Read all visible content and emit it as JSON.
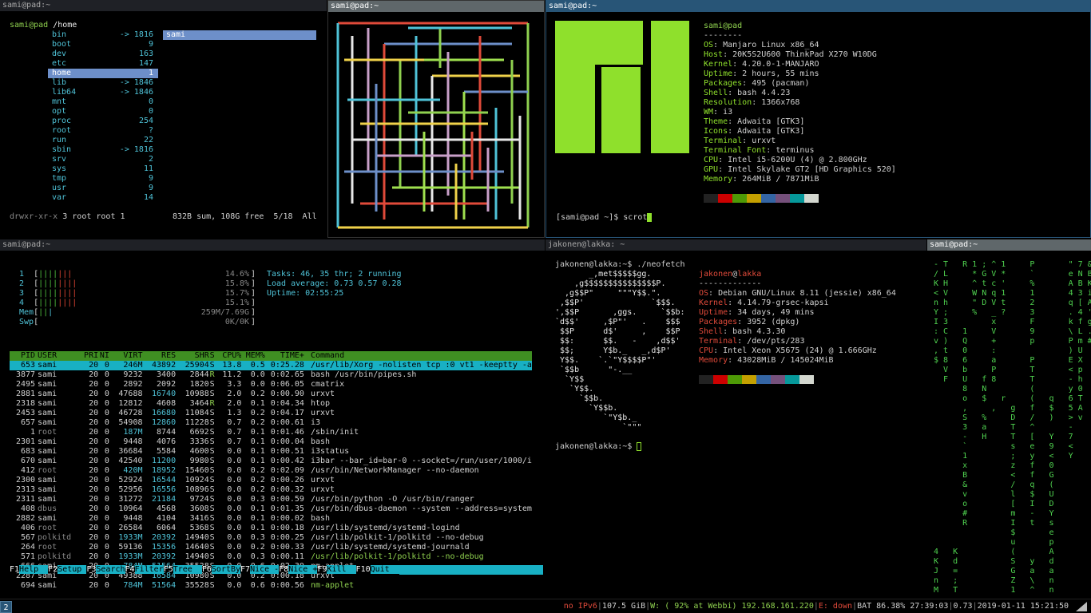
{
  "ranger": {
    "title": "sami@pad:~",
    "path_user": "sami@pad",
    "path_dir": "/home",
    "entries": [
      {
        "name": "bin",
        "size": "-> 1816",
        "link": true
      },
      {
        "name": "boot",
        "size": "9"
      },
      {
        "name": "dev",
        "size": "163"
      },
      {
        "name": "etc",
        "size": "147"
      },
      {
        "name": "home",
        "size": "1",
        "selected": true
      },
      {
        "name": "lib",
        "size": "-> 1846",
        "link": true
      },
      {
        "name": "lib64",
        "size": "-> 1846",
        "link": true
      },
      {
        "name": "mnt",
        "size": "0"
      },
      {
        "name": "opt",
        "size": "0"
      },
      {
        "name": "proc",
        "size": "254"
      },
      {
        "name": "root",
        "size": "?"
      },
      {
        "name": "run",
        "size": "22"
      },
      {
        "name": "sbin",
        "size": "-> 1816",
        "link": true
      },
      {
        "name": "srv",
        "size": "2"
      },
      {
        "name": "sys",
        "size": "11"
      },
      {
        "name": "tmp",
        "size": "9"
      },
      {
        "name": "usr",
        "size": "9"
      },
      {
        "name": "var",
        "size": "14"
      }
    ],
    "preview_item": "sami",
    "status_perms": "drwxr-xr-x",
    "status_info": "3 root root 1",
    "status_right": "832B sum, 108G free  5/18  All"
  },
  "pipes": {
    "title": "sami@pad:~"
  },
  "neofetch_top": {
    "title": "sami@pad:~",
    "user": "sami@pad",
    "divider": "--------",
    "info": [
      {
        "key": "OS",
        "value": "Manjaro Linux x86_64"
      },
      {
        "key": "Host",
        "value": "20K5S2U600 ThinkPad X270 W10DG"
      },
      {
        "key": "Kernel",
        "value": "4.20.0-1-MANJARO"
      },
      {
        "key": "Uptime",
        "value": "2 hours, 55 mins"
      },
      {
        "key": "Packages",
        "value": "495 (pacman)"
      },
      {
        "key": "Shell",
        "value": "bash 4.4.23"
      },
      {
        "key": "Resolution",
        "value": "1366x768"
      },
      {
        "key": "WM",
        "value": "i3"
      },
      {
        "key": "Theme",
        "value": "Adwaita [GTK3]"
      },
      {
        "key": "Icons",
        "value": "Adwaita [GTK3]"
      },
      {
        "key": "Terminal",
        "value": "urxvt"
      },
      {
        "key": "Terminal Font",
        "value": "terminus"
      },
      {
        "key": "CPU",
        "value": "Intel i5-6200U (4) @ 2.800GHz"
      },
      {
        "key": "GPU",
        "value": "Intel Skylake GT2 [HD Graphics 520]"
      },
      {
        "key": "Memory",
        "value": "264MiB / 7871MiB"
      }
    ],
    "palette": [
      "#222222",
      "#cc0000",
      "#4e9a06",
      "#c4a000",
      "#3465a4",
      "#75507b",
      "#06989a",
      "#d3d7cf"
    ],
    "prompt": "[sami@pad ~]$ scrot",
    "logo_color": "#8fe02c"
  },
  "htop": {
    "title": "sami@pad:~",
    "cpus": [
      {
        "n": "1",
        "pct": "14.6%"
      },
      {
        "n": "2",
        "pct": "15.8%"
      },
      {
        "n": "3",
        "pct": "15.7%"
      },
      {
        "n": "4",
        "pct": "15.1%"
      }
    ],
    "mem_label": "Mem",
    "mem_value": "259M/7.69G",
    "swp_label": "Swp",
    "swp_value": "0K/0K",
    "tasks": "Tasks: 46, 35 thr; 2 running",
    "load": "Load average: 0.73 0.57 0.28",
    "uptime": "Uptime: 02:55:25",
    "columns": [
      "PID",
      "USER",
      "PRI",
      "NI",
      "VIRT",
      "RES",
      "SHR",
      "S",
      "CPU%",
      "MEM%",
      "TIME+",
      "Command"
    ],
    "rows": [
      [
        "653",
        "sami",
        "20",
        "0",
        "246M",
        "43892",
        "25904",
        "S",
        "13.8",
        "0.5",
        "0:25.28",
        "/usr/lib/Xorg -nolisten tcp :0 vt1 -keeptty -a"
      ],
      [
        "3877",
        "sami",
        "20",
        "0",
        "9232",
        "3400",
        "2844",
        "R",
        "11.2",
        "0.0",
        "0:02.65",
        "bash /usr/bin/pipes.sh"
      ],
      [
        "2495",
        "sami",
        "20",
        "0",
        "2892",
        "2092",
        "1820",
        "S",
        "3.3",
        "0.0",
        "0:06.05",
        "cmatrix"
      ],
      [
        "2881",
        "sami",
        "20",
        "0",
        "47688",
        "16740",
        "10988",
        "S",
        "2.0",
        "0.2",
        "0:00.90",
        "urxvt"
      ],
      [
        "2318",
        "sami",
        "20",
        "0",
        "12812",
        "4608",
        "3464",
        "R",
        "2.0",
        "0.1",
        "0:04.34",
        "htop"
      ],
      [
        "2453",
        "sami",
        "20",
        "0",
        "46728",
        "16680",
        "11084",
        "S",
        "1.3",
        "0.2",
        "0:04.17",
        "urxvt"
      ],
      [
        "657",
        "sami",
        "20",
        "0",
        "54908",
        "12860",
        "11228",
        "S",
        "0.7",
        "0.2",
        "0:00.61",
        "i3"
      ],
      [
        "1",
        "root",
        "20",
        "0",
        "187M",
        "8744",
        "6692",
        "S",
        "0.7",
        "0.1",
        "0:01.46",
        "/sbin/init"
      ],
      [
        "2301",
        "sami",
        "20",
        "0",
        "9448",
        "4076",
        "3336",
        "S",
        "0.7",
        "0.1",
        "0:00.04",
        "bash"
      ],
      [
        "683",
        "sami",
        "20",
        "0",
        "36684",
        "5584",
        "4600",
        "S",
        "0.0",
        "0.1",
        "0:00.51",
        "i3status"
      ],
      [
        "670",
        "sami",
        "20",
        "0",
        "42540",
        "11200",
        "9980",
        "S",
        "0.0",
        "0.1",
        "0:00.42",
        "i3bar --bar_id=bar-0 --socket=/run/user/1000/i"
      ],
      [
        "412",
        "root",
        "20",
        "0",
        "420M",
        "18952",
        "15460",
        "S",
        "0.0",
        "0.2",
        "0:02.09",
        "/usr/bin/NetworkManager --no-daemon"
      ],
      [
        "2300",
        "sami",
        "20",
        "0",
        "52924",
        "16544",
        "10924",
        "S",
        "0.0",
        "0.2",
        "0:00.26",
        "urxvt"
      ],
      [
        "2313",
        "sami",
        "20",
        "0",
        "52956",
        "16556",
        "10896",
        "S",
        "0.0",
        "0.2",
        "0:00.32",
        "urxvt"
      ],
      [
        "2311",
        "sami",
        "20",
        "0",
        "31272",
        "21184",
        "9724",
        "S",
        "0.0",
        "0.3",
        "0:00.59",
        "/usr/bin/python -O /usr/bin/ranger"
      ],
      [
        "408",
        "dbus",
        "20",
        "0",
        "10964",
        "4568",
        "3608",
        "S",
        "0.0",
        "0.1",
        "0:01.35",
        "/usr/bin/dbus-daemon --system --address=system"
      ],
      [
        "2882",
        "sami",
        "20",
        "0",
        "9448",
        "4104",
        "3416",
        "S",
        "0.0",
        "0.1",
        "0:00.02",
        "bash"
      ],
      [
        "406",
        "root",
        "20",
        "0",
        "26584",
        "6064",
        "5368",
        "S",
        "0.0",
        "0.1",
        "0:00.18",
        "/usr/lib/systemd/systemd-logind"
      ],
      [
        "567",
        "polkitd",
        "20",
        "0",
        "1933M",
        "20392",
        "14940",
        "S",
        "0.0",
        "0.3",
        "0:00.25",
        "/usr/lib/polkit-1/polkitd --no-debug"
      ],
      [
        "264",
        "root",
        "20",
        "0",
        "59136",
        "15356",
        "14640",
        "S",
        "0.0",
        "0.2",
        "0:00.33",
        "/usr/lib/systemd/systemd-journald"
      ],
      [
        "571",
        "polkitd",
        "20",
        "0",
        "1933M",
        "20392",
        "14940",
        "S",
        "0.0",
        "0.3",
        "0:00.11",
        "/usr/lib/polkit-1/polkitd --no-debug"
      ],
      [
        "666",
        "sami",
        "20",
        "0",
        "784M",
        "51564",
        "35528",
        "S",
        "0.0",
        "0.6",
        "0:02.30",
        "nm-applet"
      ],
      [
        "2287",
        "sami",
        "20",
        "0",
        "49388",
        "16584",
        "10980",
        "S",
        "0.0",
        "0.2",
        "0:00.18",
        "urxvt"
      ],
      [
        "694",
        "sami",
        "20",
        "0",
        "784M",
        "51564",
        "35528",
        "S",
        "0.0",
        "0.6",
        "0:00.56",
        "nm-applet"
      ]
    ],
    "fkeys": [
      {
        "k": "F1",
        "l": "Help  "
      },
      {
        "k": "F2",
        "l": "Setup "
      },
      {
        "k": "F3",
        "l": "Search"
      },
      {
        "k": "F4",
        "l": "Filter"
      },
      {
        "k": "F5",
        "l": "Tree  "
      },
      {
        "k": "F6",
        "l": "SortBy"
      },
      {
        "k": "F7",
        "l": "Nice -"
      },
      {
        "k": "F8",
        "l": "Nice +"
      },
      {
        "k": "F9",
        "l": "Kill  "
      },
      {
        "k": "F10",
        "l": "Quit  "
      }
    ]
  },
  "neofetch_debian": {
    "title": "jakonen@lakka: ~",
    "command": "jakonen@lakka:~$ ./neofetch",
    "user": "jakonen",
    "host": "lakka",
    "divider": "-------------",
    "logo": [
      "       _,met$$$$$gg.",
      "    ,g$$$$$$$$$$$$$$$P.",
      "  ,g$$P\"     \"\"\"Y$$.\".",
      " ,$$P'              `$$$.",
      "',$$P       ,ggs.     `$$b:",
      "`d$$'     ,$P\"'   .    $$$",
      " $$P      d$'     ,    $$P",
      " $$:      $$.   -    ,d$$'",
      " $$;      Y$b._   _,d$P'",
      " Y$$.    `.`\"Y$$$$P\"'",
      " `$$b      \"-.__",
      "  `Y$$",
      "   `Y$$.",
      "     `$$b.",
      "       `Y$$b.",
      "          `\"Y$b._",
      "              `\"\"\""
    ],
    "info": [
      {
        "key": "OS",
        "value": "Debian GNU/Linux 8.11 (jessie) x86_64"
      },
      {
        "key": "Kernel",
        "value": "4.14.79-grsec-kapsi"
      },
      {
        "key": "Uptime",
        "value": "34 days, 49 mins"
      },
      {
        "key": "Packages",
        "value": "3952 (dpkg)"
      },
      {
        "key": "Shell",
        "value": "bash 4.3.30"
      },
      {
        "key": "Terminal",
        "value": "/dev/pts/283"
      },
      {
        "key": "CPU",
        "value": "Intel Xeon X5675 (24) @ 1.666GHz"
      },
      {
        "key": "Memory",
        "value": "43028MiB / 145024MiB"
      }
    ],
    "palette": [
      "#222222",
      "#cc0000",
      "#4e9a06",
      "#c4a000",
      "#3465a4",
      "#75507b",
      "#06989a",
      "#d3d7cf"
    ],
    "prompt": "jakonen@lakka:~$ "
  },
  "cmatrix": {
    "title": "sami@pad:~",
    "lines": [
      "- T   R 1 ; ^ 1     P       \" 7 &",
      "/ L     * G V *     `       e N B",
      "K H     ^ t c '     %       A B K",
      "< V     W N q 1     1       4 3 i",
      "n h     \" D V t     2       q [ A",
      "Y ;     %   _ ?     3       . 4 '",
      "I 3         x       F       k f g",
      ": C   1     V       9       \\ L .",
      "v )   Q     +       p       P m #",
      ", t   0     :               ) U",
      "$ 8   6     a       P       E X",
      "  V   b     P       T       < p",
      "  F   U   f 8       T       - h",
      "      8   N         (       y 0",
      "      o   $   r     (   q   6 T",
      "      ,     ,   g   f   $   5 A",
      "      S   %     D   /   )   > v",
      "      3   a     T   ^       -",
      "      -   H     T   [   Y   7",
      "      `         s   e   9   <",
      "      1         ;   y   <   Y",
      "      x         z   f   0",
      "      B         <   f   G",
      "      &         /   q   (",
      "      v         l   $   U",
      "      o         [   I   D",
      "      #         m   -   Y",
      "      R         I   t   s",
      "                $       e",
      "                u       p",
      "4   K           (       A",
      "K   d           S   y   d",
      "J   =           G   a   a",
      "n   ;           Z   \\   n",
      "M   T           1   ^   n"
    ]
  },
  "statusbar": {
    "workspace": "2",
    "ipv6": "no IPv6",
    "disk": "107.5 GiB",
    "wifi": "W: ( 92% at Webbi) 192.168.161.220",
    "eth": "E: down",
    "battery": "BAT 86.38% 27:39:03",
    "load": "0.73",
    "datetime": "2019-01-11 15:21:50"
  }
}
